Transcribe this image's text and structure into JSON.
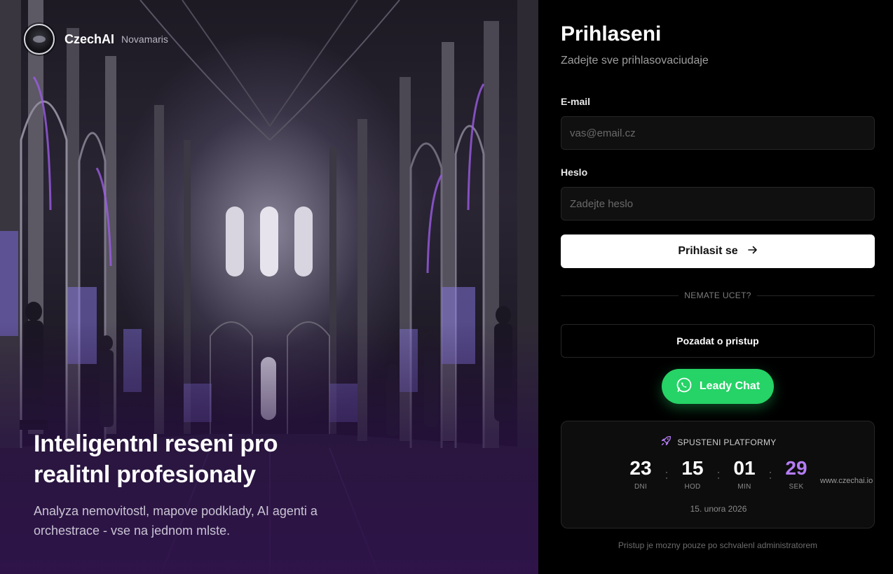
{
  "brand": {
    "name": "CzechAI",
    "subtitle": "Novamaris"
  },
  "hero": {
    "title_line1": "Inteligentnl reseni pro",
    "title_line2": "realitnl profesionaly",
    "desc_line1": "Analyza nemovitostl, mapove podklady, AI agenti a",
    "desc_line2": "orchestrace - vse na jednom mlste."
  },
  "login": {
    "title": "Prihlaseni",
    "subtitle": "Zadejte sve prihlasovaciudaje",
    "email_label": "E-mail",
    "email_placeholder": "vas@email.cz",
    "password_label": "Heslo",
    "password_placeholder": "Zadejte heslo",
    "submit_label": "Prihlasit se",
    "divider_text": "NEMATE UCET?",
    "request_access_label": "Pozadat o pristup",
    "chat_label": "Leady Chat"
  },
  "countdown": {
    "heading": "SPUSTENI PLATFORMY",
    "days": "23",
    "days_label": "DNI",
    "hours": "15",
    "hours_label": "HOD",
    "minutes": "01",
    "minutes_label": "MIN",
    "seconds": "29",
    "seconds_label": "SEK",
    "separator": ":",
    "date": "15. unora 2026"
  },
  "watermark": "www.czechai.io",
  "footer_note": "Pristup je mozny pouze po schvalenl administratorem",
  "colors": {
    "accent_purple": "#b57cf5",
    "whatsapp_green": "#25d366",
    "panel_bg": "#000000",
    "field_bg": "#101010"
  },
  "icons": {
    "submit": "arrow-right-icon",
    "chat": "whatsapp-icon",
    "countdown": "rocket-icon",
    "brand": "brand-logo-icon"
  }
}
